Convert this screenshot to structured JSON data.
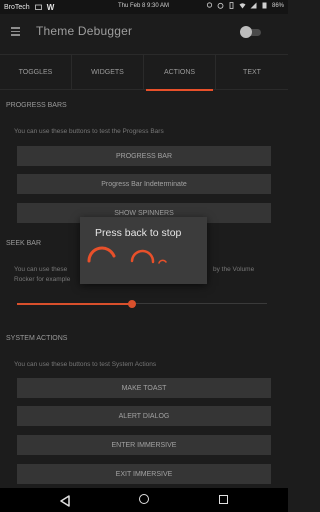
{
  "status_bar": {
    "carrier": "BroTech",
    "app_glyph": "W",
    "datetime": "Thu Feb 8 9:30 AM",
    "battery": "86%"
  },
  "app_bar": {
    "title": "Theme Debugger",
    "menu_icon": "hamburger-menu-icon",
    "toggle_state": "off"
  },
  "tabs": [
    {
      "label": "TOGGLES",
      "active": false
    },
    {
      "label": "WIDGETS",
      "active": false
    },
    {
      "label": "ACTIONS",
      "active": true
    },
    {
      "label": "TEXT",
      "active": false
    }
  ],
  "progress_bars": {
    "heading": "PROGRESS BARS",
    "description": "You can use these buttons to test the Progress Bars",
    "buttons": [
      "PROGRESS BAR",
      "Progress Bar Indeterminate",
      "SHOW SPINNERS"
    ]
  },
  "seek_bar": {
    "heading": "SEEK BAR",
    "description_left": "You can use these",
    "description_right": "by the Volume",
    "description_line2": "Rocker for example",
    "progress": 0.46
  },
  "system_actions": {
    "heading": "SYSTEM ACTIONS",
    "description": "You can use these buttons to test System Actions",
    "buttons": [
      "MAKE TOAST",
      "ALERT DIALOG",
      "ENTER IMMERSIVE",
      "EXIT IMMERSIVE"
    ]
  },
  "dialog": {
    "text": "Press back to stop"
  },
  "colors": {
    "accent": "#e8502a",
    "background": "#1c1c1c",
    "button": "#353535",
    "dialog": "#3c3c3c"
  }
}
